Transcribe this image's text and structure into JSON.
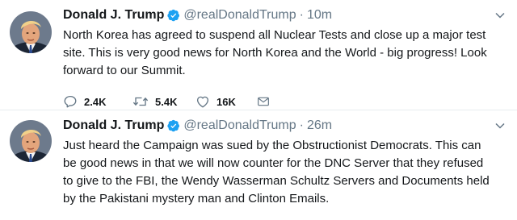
{
  "tweets": [
    {
      "name": "Donald J. Trump",
      "handle": "@realDonaldTrump",
      "separator": "·",
      "time": "10m",
      "text": "North Korea has agreed to suspend all Nuclear Tests and close up a major test\nsite. This is very good news for North Korea and the World - big progress! Look\nforward to our Summit.",
      "replies": "2.4K",
      "retweets": "5.4K",
      "likes": "16K"
    },
    {
      "name": "Donald J. Trump",
      "handle": "@realDonaldTrump",
      "separator": "·",
      "time": "26m",
      "text": "Just heard the Campaign was sued by the Obstructionist Democrats. This can\nbe good news in that we will now counter for the DNC Server that they refused\nto give to the FBI, the Wendy Wasserman Schultz Servers and Documents held\nby the Pakistani mystery man and Clinton Emails."
    }
  ],
  "colors": {
    "verified": "#1da1f2",
    "secondary_text": "#657786",
    "primary_text": "#14171a",
    "divider": "#e6ecf0"
  },
  "icons": {
    "reply": "reply-icon",
    "retweet": "retweet-icon",
    "like": "heart-icon",
    "dm": "envelope-icon",
    "verified": "verified-badge-icon",
    "menu": "chevron-down-icon"
  }
}
